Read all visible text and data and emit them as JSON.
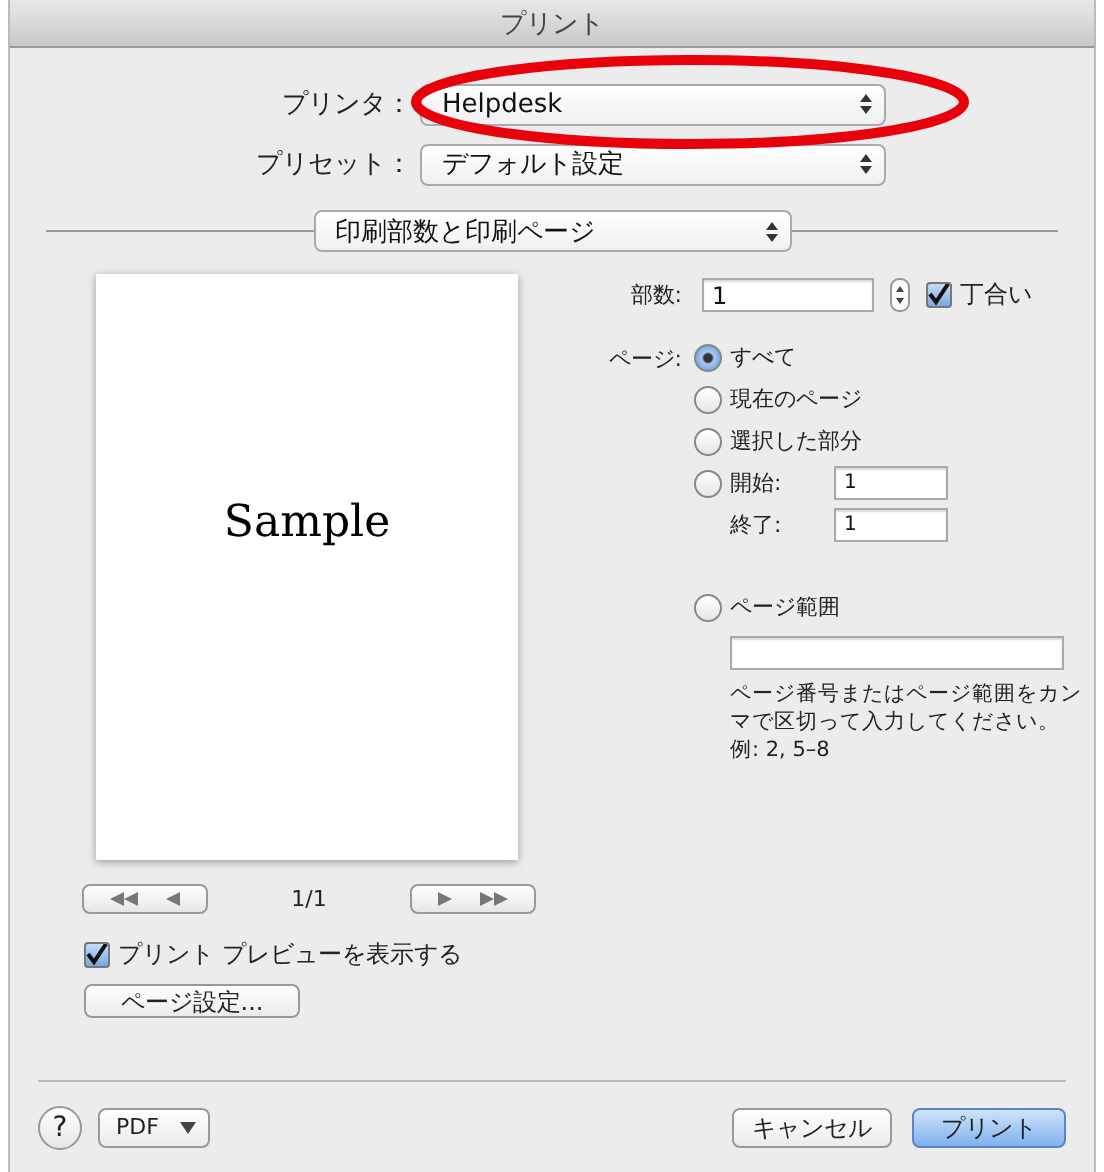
{
  "window": {
    "title": "プリント"
  },
  "printer": {
    "label": "プリンタ：",
    "value": "Helpdesk",
    "annotation": {
      "kind": "ellipse",
      "color": "#e8000b"
    }
  },
  "preset": {
    "label": "プリセット：",
    "value": "デフォルト設定"
  },
  "section_popup": {
    "value": "印刷部数と印刷ページ"
  },
  "preview": {
    "sample_text": "Sample",
    "page_indicator": "1/1",
    "show_preview": {
      "label": "プリント プレビューを表示する",
      "checked": true
    },
    "page_setup_button": "ページ設定..."
  },
  "copies": {
    "label": "部数:",
    "value": "1",
    "collate": {
      "label": "丁合い",
      "checked": true
    }
  },
  "pages": {
    "label": "ページ:",
    "options": [
      {
        "kind": "plain",
        "label": "すべて",
        "selected": true
      },
      {
        "kind": "plain",
        "label": "現在のページ",
        "selected": false
      },
      {
        "kind": "plain",
        "label": "選択した部分",
        "selected": false
      },
      {
        "kind": "from_to",
        "label": "開始:",
        "value": "1",
        "to_label": "終了:",
        "to_value": "1",
        "selected": false
      },
      {
        "kind": "range",
        "label": "ページ範囲",
        "help": "ページ番号またはページ範囲をカンマで区切って入力してください。",
        "example": "例: 2, 5–8",
        "selected": false
      }
    ]
  },
  "footer": {
    "help": "?",
    "pdf": "PDF",
    "buttons": [
      {
        "label": "キャンセル",
        "kind": "normal"
      },
      {
        "label": "プリント",
        "kind": "default"
      }
    ]
  }
}
